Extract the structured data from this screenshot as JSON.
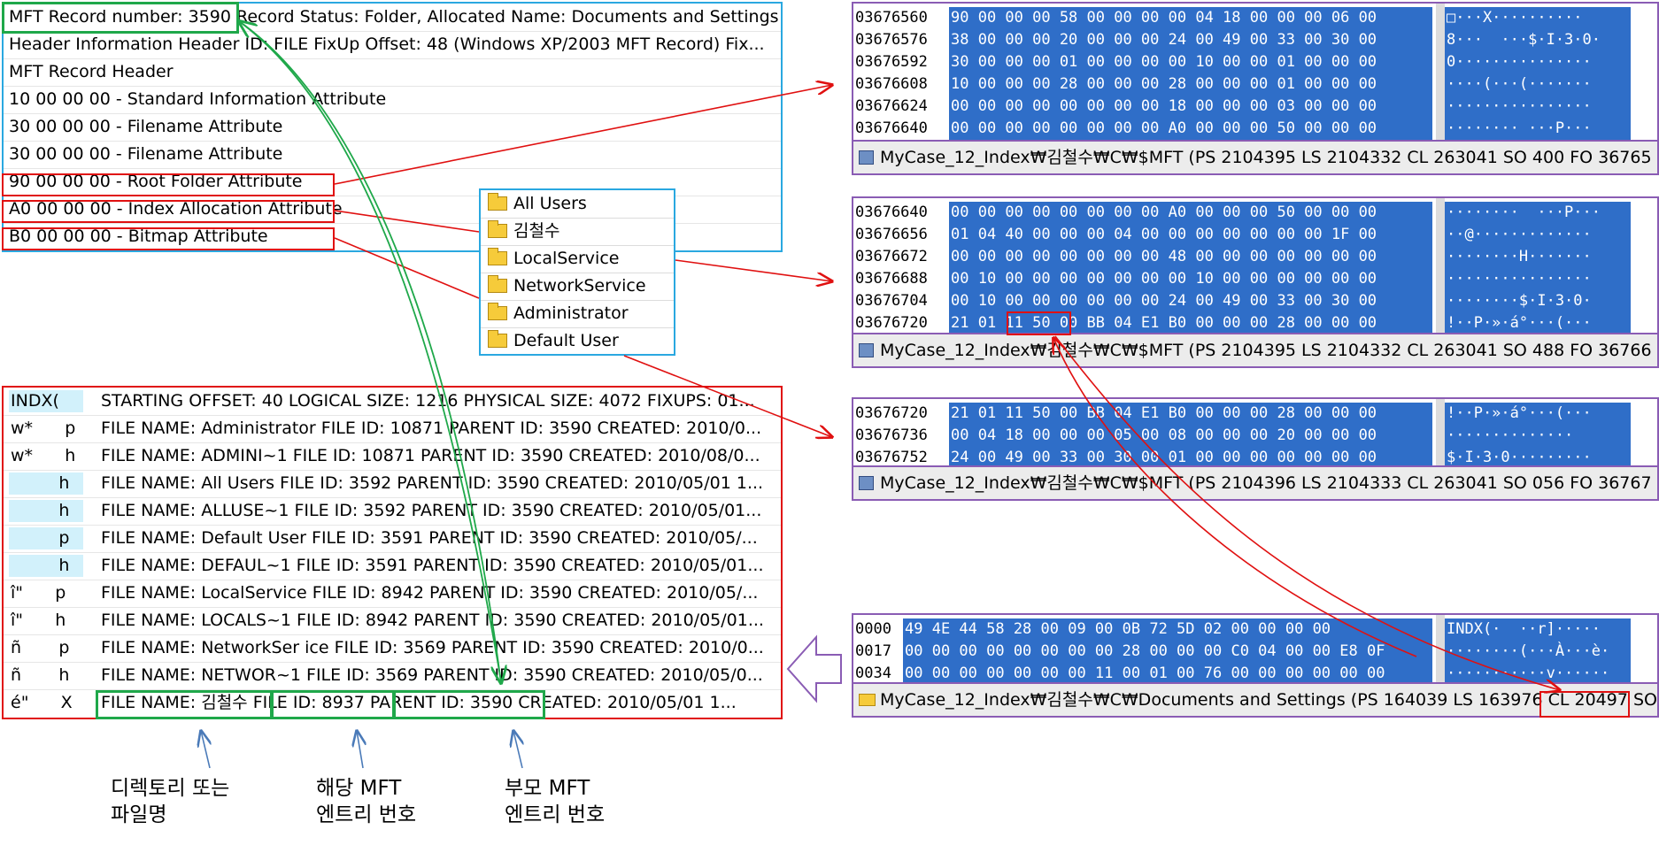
{
  "mft": {
    "rows": [
      "MFT Record number:  3590 Record Status:  Folder, Allocated Name:  Documents and Settings",
      " Header Information Header ID:    FILE FixUp Offset:    48 (Windows XP/2003 MFT Record) Fix...",
      "MFT Record Header",
      "10 00 00 00 - Standard Information Attribute",
      "30 00 00 00 - Filename Attribute",
      "30 00 00 00 - Filename Attribute",
      "90 00 00 00 - Root Folder Attribute",
      "A0 00 00 00 - Index Allocation Attribute",
      "B0 00 00 00 - Bitmap Attribute"
    ]
  },
  "folders": [
    "All Users",
    "김철수",
    "LocalService",
    "NetworkService",
    "Administrator",
    "Default User"
  ],
  "indx": {
    "rows": [
      {
        "tag": "INDX(",
        "text": "STARTING OFFSET: 40 LOGICAL SIZE: 1216 PHYSICAL SIZE: 4072 FIXUPS: 01..."
      },
      {
        "tag": "w*      p",
        "text": "FILE NAME: Administrator FILE ID: 10871 PARENT ID: 3590 CREATED: 2010/0..."
      },
      {
        "tag": "w*      h",
        "text": "FILE NAME: ADMINI~1 FILE ID: 10871 PARENT ID: 3590 CREATED: 2010/08/0..."
      },
      {
        "tag": "         h",
        "text": "FILE NAME: All Users FILE ID: 3592 PARENT ID: 3590 CREATED: 2010/05/01 1..."
      },
      {
        "tag": "         h",
        "text": "FILE NAME: ALLUSE~1 FILE ID: 3592 PARENT ID: 3590 CREATED: 2010/05/01..."
      },
      {
        "tag": "         p",
        "text": "FILE NAME: Default User FILE ID: 3591 PARENT ID: 3590 CREATED: 2010/05/..."
      },
      {
        "tag": "         h",
        "text": "FILE NAME: DEFAUL~1 FILE ID: 3591 PARENT ID: 3590 CREATED: 2010/05/01..."
      },
      {
        "tag": "î\"      p",
        "text": "FILE NAME: LocalService FILE ID: 8942 PARENT ID: 3590 CREATED: 2010/05/..."
      },
      {
        "tag": "î\"      h",
        "text": "FILE NAME: LOCALS~1 FILE ID: 8942 PARENT ID: 3590 CREATED: 2010/05/01..."
      },
      {
        "tag": "ñ       p",
        "text": "FILE NAME: NetworkSer ice FILE ID: 3569 PARENT ID: 3590 CREATED: 2010/0..."
      },
      {
        "tag": "ñ       h",
        "text": "FILE NAME: NETWOR~1 FILE ID: 3569 PARENT ID: 3590 CREATED: 2010/05/0..."
      },
      {
        "tag": "é\"      X",
        "text": "FILE NAME: 김철수 FILE ID: 8937 PARENT ID: 3590 CREATED: 2010/05/01 1..."
      }
    ]
  },
  "hex1": {
    "rows": [
      {
        "off": "03676560",
        "hex": "90 00 00 00 58 00 00 00 00 04 18 00 00 00 06 00",
        "asc": "□···X··········"
      },
      {
        "off": "03676576",
        "hex": "38 00 00 00 20 00 00 00 24 00 49 00 33 00 30 00",
        "asc": "8···  ···$·I·3·0·"
      },
      {
        "off": "03676592",
        "hex": "30 00 00 00 01 00 00 00 00 10 00 00 01 00 00 00",
        "asc": "0···············"
      },
      {
        "off": "03676608",
        "hex": "10 00 00 00 28 00 00 00 28 00 00 00 01 00 00 00",
        "asc": "····(···(·······"
      },
      {
        "off": "03676624",
        "hex": "00 00 00 00 00 00 00 00 18 00 00 00 03 00 00 00",
        "asc": "················"
      },
      {
        "off": "03676640",
        "hex": "00 00 00 00 00 00 00 00 A0 00 00 00 50 00 00 00",
        "asc": "········ ···P···"
      }
    ],
    "status": "MyCase_12_Index₩김철수₩C₩$MFT (PS 2104395  LS 2104332  CL 263041  SO 400  FO 36765"
  },
  "hex2": {
    "rows": [
      {
        "off": "03676640",
        "hex": "00 00 00 00 00 00 00 00 A0 00 00 00 50 00 00 00",
        "asc": "········  ···P···"
      },
      {
        "off": "03676656",
        "hex": "01 04 40 00 00 00 04 00 00 00 00 00 00 00 1F 00",
        "asc": "··@·············"
      },
      {
        "off": "03676672",
        "hex": "00 00 00 00 00 00 00 00 48 00 00 00 00 00 00 00",
        "asc": "········H·······"
      },
      {
        "off": "03676688",
        "hex": "00 10 00 00 00 00 00 00 00 10 00 00 00 00 00 00",
        "asc": "················"
      },
      {
        "off": "03676704",
        "hex": "00 10 00 00 00 00 00 00 24 00 49 00 33 00 30 00",
        "asc": "········$·I·3·0·"
      },
      {
        "off": "03676720",
        "hex": "21 01 11 50 00 BB 04 E1 B0 00 00 00 28 00 00 00",
        "asc": "!··P·»·á°···(···"
      }
    ],
    "status": "MyCase_12_Index₩김철수₩C₩$MFT (PS 2104395  LS 2104332  CL 263041  SO 488  FO 36766"
  },
  "hex3": {
    "rows": [
      {
        "off": "03676720",
        "hex": "21 01 11 50 00 BB 04 E1 B0 00 00 00 28 00 00 00",
        "asc": "!··P·»·á°···(···"
      },
      {
        "off": "03676736",
        "hex": "00 04 18 00 00 00 05 00 08 00 00 00 20 00 00 00",
        "asc": "··············  "
      },
      {
        "off": "03676752",
        "hex": "24 00 49 00 33 00 30 00 01 00 00 00 00 00 00 00",
        "asc": "$·I·3·0·········"
      }
    ],
    "status": "MyCase_12_Index₩김철수₩C₩$MFT (PS 2104396  LS 2104333  CL 263041  SO 056  FO 36767"
  },
  "hex4": {
    "rows": [
      {
        "off": "0000",
        "hex": "49 4E 44 58 28 00 09 00 0B 72 5D 02 00 00 00 00",
        "asc": "INDX(·  ··r]·····"
      },
      {
        "off": "0017",
        "hex": "00 00 00 00 00 00 00 00 28 00 00 00 C0 04 00 00 E8 0F",
        "asc": "········(···À···è·"
      },
      {
        "off": "0034",
        "hex": "00 00 00 00 00 00 00 11 00 01 00 76 00 00 00 00 00 00",
        "asc": "···········v······"
      }
    ],
    "status": "MyCase_12_Index₩김철수₩C₩Documents and Settings (PS 164039  LS 163976  CL 20497  SO"
  },
  "annotations": {
    "name": "디렉토리 또는\n파일명",
    "id": "해당 MFT\n엔트리 번호",
    "parent": "부모 MFT\n엔트리 번호"
  },
  "colors": {
    "red": "#e01010",
    "green": "#1fa84a",
    "blue": "#2aa8e0",
    "hex_bg": "#2f6ec8",
    "purple": "#8a5cb4"
  }
}
